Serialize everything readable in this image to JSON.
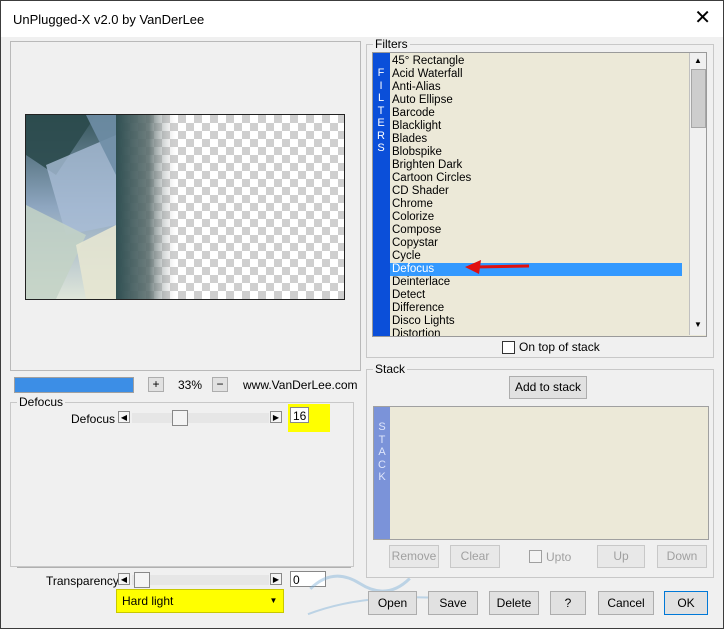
{
  "window": {
    "title": "UnPlugged-X v2.0 by VanDerLee",
    "close_glyph": "✕"
  },
  "zoom": {
    "minus": "−",
    "plus": "+",
    "value": "33%",
    "website": "www.VanDerLee.com",
    "progress": 1.0
  },
  "defocus_group": {
    "title": "Defocus",
    "slider_label": "Defocus",
    "value": "16"
  },
  "transparency": {
    "label": "Transparency",
    "value": "0"
  },
  "blend_mode": {
    "selected": "Hard light"
  },
  "filters": {
    "title": "Filters",
    "band_letters": [
      "F",
      "I",
      "L",
      "T",
      "E",
      "R",
      "S"
    ],
    "items": [
      "45° Rectangle",
      "Acid Waterfall",
      "Anti-Alias",
      "Auto Ellipse",
      "Barcode",
      "Blacklight",
      "Blades",
      "Blobspike",
      "Brighten Dark",
      "Cartoon Circles",
      "CD Shader",
      "Chrome",
      "Colorize",
      "Compose",
      "Copystar",
      "Cycle",
      "Defocus",
      "Deinterlace",
      "Detect",
      "Difference",
      "Disco Lights",
      "Distortion"
    ],
    "selected": "Defocus",
    "on_top_label": "On top of stack"
  },
  "stack": {
    "title": "Stack",
    "add_label": "Add to stack",
    "band_letters": [
      "S",
      "T",
      "A",
      "C",
      "K"
    ],
    "remove_label": "Remove",
    "clear_label": "Clear",
    "upto_label": "Upto",
    "up_label": "Up",
    "down_label": "Down"
  },
  "footer": {
    "open": "Open",
    "save": "Save",
    "delete": "Delete",
    "help": "?",
    "cancel": "Cancel",
    "ok": "OK"
  },
  "colors": {
    "highlight": "#ffff00",
    "band_blue": "#0b4fd9",
    "stack_band": "#7b93d9",
    "selection": "#3399ff",
    "arrow": "#e01010"
  }
}
